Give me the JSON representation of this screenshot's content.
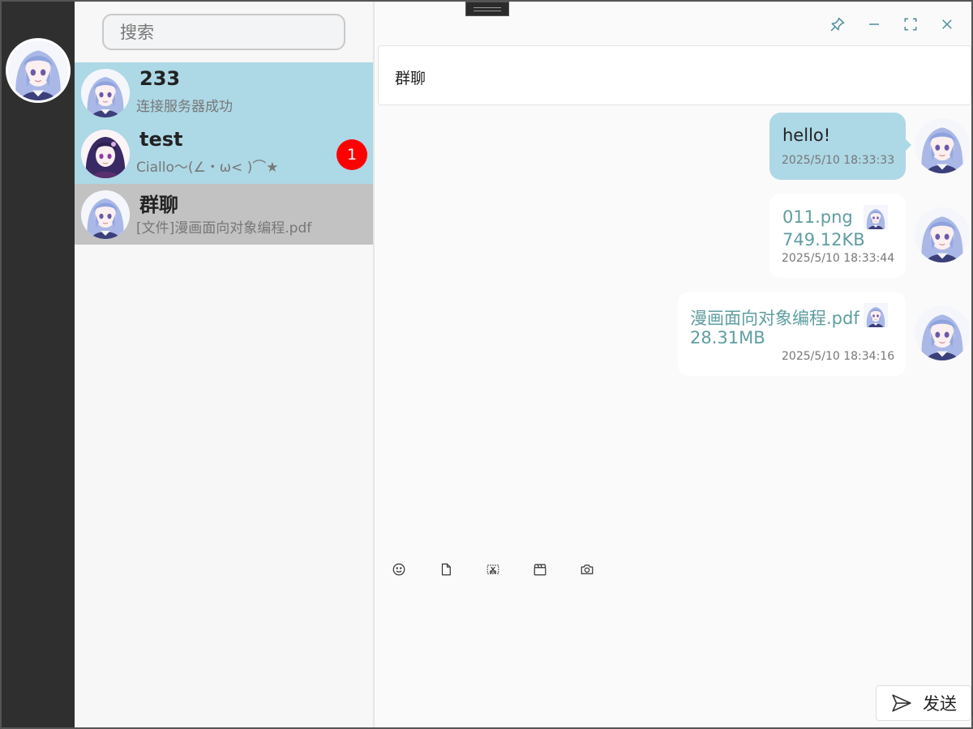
{
  "app": {
    "accent": "#add8e6",
    "file_color": "#5f9ea0",
    "badge_color": "#ff0000"
  },
  "rail": {
    "avatar_icon": "user-avatar"
  },
  "search": {
    "placeholder": "搜索",
    "icon": "search-icon"
  },
  "conversations": [
    {
      "name": "233",
      "preview": "连接服务器成功",
      "badge": ""
    },
    {
      "name": "test",
      "preview": "Ciallo～(∠・ω< )⌒★",
      "badge": "1"
    },
    {
      "name": "群聊",
      "preview": "[文件]漫画面向对象编程.pdf",
      "badge": ""
    }
  ],
  "chat": {
    "title": "群聊",
    "messages": [
      {
        "type": "text",
        "text": "hello!",
        "time": "2025/5/10 18:33:33"
      },
      {
        "type": "file",
        "file_name": "011.png",
        "file_size": "749.12KB",
        "time": "2025/5/10 18:33:44"
      },
      {
        "type": "file",
        "file_name": "漫画面向对象编程.pdf",
        "file_size": "28.31MB",
        "time": "2025/5/10 18:34:16"
      }
    ]
  },
  "window_controls": [
    "pin-icon",
    "minimize-icon",
    "maximize-icon",
    "close-icon"
  ],
  "toolbar": [
    "emoji-icon",
    "file-icon",
    "screenshot-icon",
    "video-icon",
    "camera-icon"
  ],
  "send": {
    "label": "发送",
    "icon": "send-icon"
  }
}
